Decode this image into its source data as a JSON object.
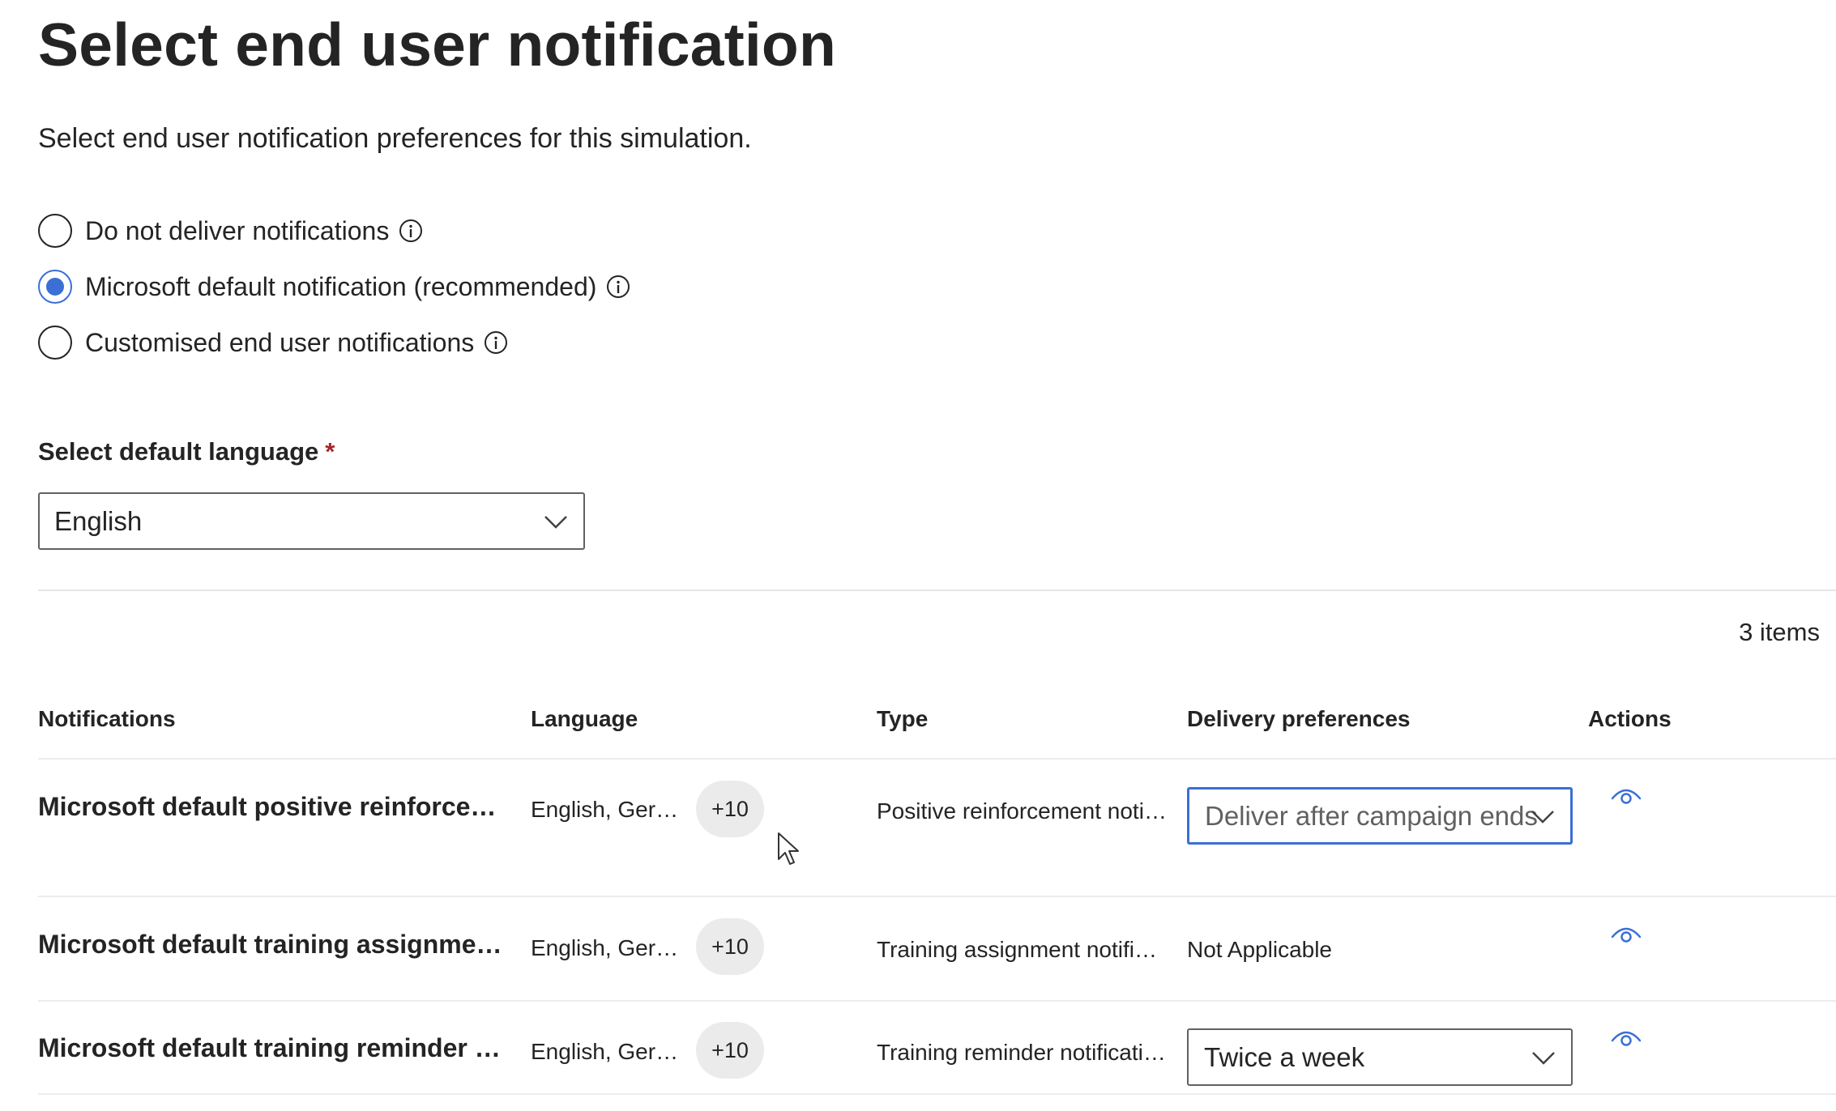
{
  "page": {
    "title": "Select end user notification",
    "subtitle": "Select end user notification preferences for this simulation."
  },
  "options": [
    {
      "label": "Do not deliver notifications",
      "checked": false,
      "icon": "info-icon"
    },
    {
      "label": "Microsoft default notification (recommended)",
      "checked": true,
      "icon": "info-icon"
    },
    {
      "label": "Customised end user notifications",
      "checked": false,
      "icon": "info-icon"
    }
  ],
  "language_field": {
    "label": "Select default language",
    "required_mark": "*",
    "value": "English"
  },
  "table": {
    "item_count": "3 items",
    "headers": {
      "notifications": "Notifications",
      "language": "Language",
      "type": "Type",
      "delivery": "Delivery preferences",
      "actions": "Actions"
    },
    "rows": [
      {
        "name": "Microsoft default positive reinforcemen...",
        "language": "English, German...",
        "extra": "+10",
        "type": "Positive reinforcement notifi...",
        "delivery": "Deliver after campaign ends",
        "delivery_kind": "dropdown",
        "action_icon": "eye-icon"
      },
      {
        "name": "Microsoft default training assignment n...",
        "language": "English, German...",
        "extra": "+10",
        "type": "Training assignment notificat...",
        "delivery": "Not Applicable",
        "delivery_kind": "text",
        "action_icon": "eye-icon"
      },
      {
        "name": "Microsoft default training reminder not...",
        "language": "English, German...",
        "extra": "+10",
        "type": "Training reminder notification",
        "delivery": "Twice a week",
        "delivery_kind": "dropdown",
        "action_icon": "eye-icon"
      }
    ]
  },
  "colors": {
    "accent": "#3b6fd6",
    "text": "#242424",
    "required": "#a4262c",
    "badge_bg": "#ebebeb"
  }
}
